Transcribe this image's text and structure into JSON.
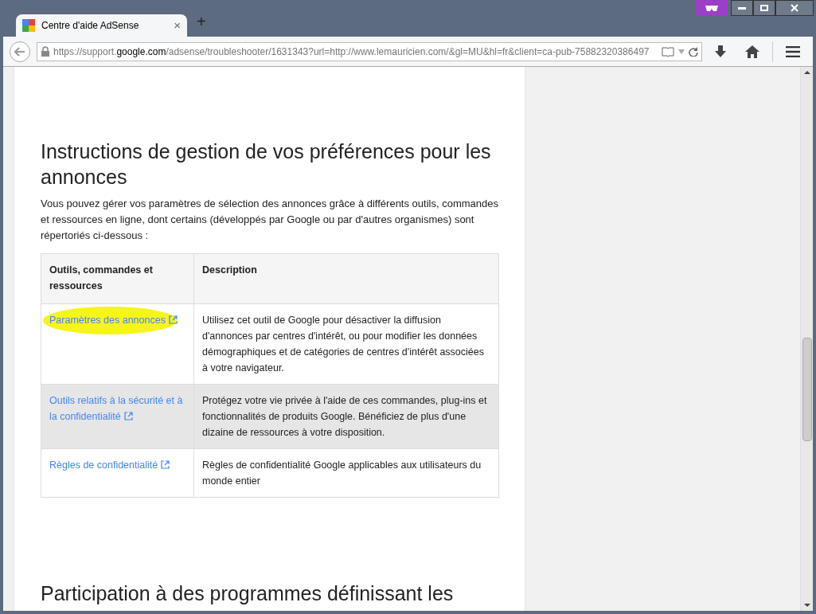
{
  "tab": {
    "title": "Centre d'aide AdSense",
    "close": "×",
    "new_tab": "+"
  },
  "address_bar": {
    "scheme": "https://support.",
    "domain": "google.com",
    "path": "/adsense/troubleshooter/1631343?url=http://www.lemauricien.com/&gl=MU&hl=fr&client=ca-pub-75882320386497"
  },
  "article": {
    "heading": "Instructions de gestion de vos préférences pour les annonces",
    "intro": "Vous pouvez gérer vos paramètres de sélection des annonces grâce à différents outils, commandes et ressources en ligne, dont certains (développés par Google ou par d'autres organismes) sont répertoriés ci-dessous :",
    "table": {
      "columns": [
        "Outils, commandes et ressources",
        "Description"
      ],
      "rows": [
        {
          "link": "Paramètres des annonces",
          "description": "Utilisez cet outil de Google pour désactiver la diffusion d'annonces par centres d'intérêt, ou pour modifier les données démographiques et de catégories de centres d'intérêt associées à votre navigateur.",
          "highlighted": false,
          "marked": true
        },
        {
          "link": "Outils relatifs à la sécurité et à la confidentialité",
          "description": "Protégez votre vie privée à l'aide de ces commandes, plug-ins et fonctionnalités de produits Google. Bénéficiez de plus d'une dizaine de ressources à votre disposition.",
          "highlighted": true,
          "marked": false
        },
        {
          "link": "Règles de confidentialité",
          "description": "Règles de confidentialité Google applicables aux utilisateurs du monde entier",
          "highlighted": false,
          "marked": false
        }
      ]
    },
    "next_heading": "Participation à des programmes définissant les"
  }
}
